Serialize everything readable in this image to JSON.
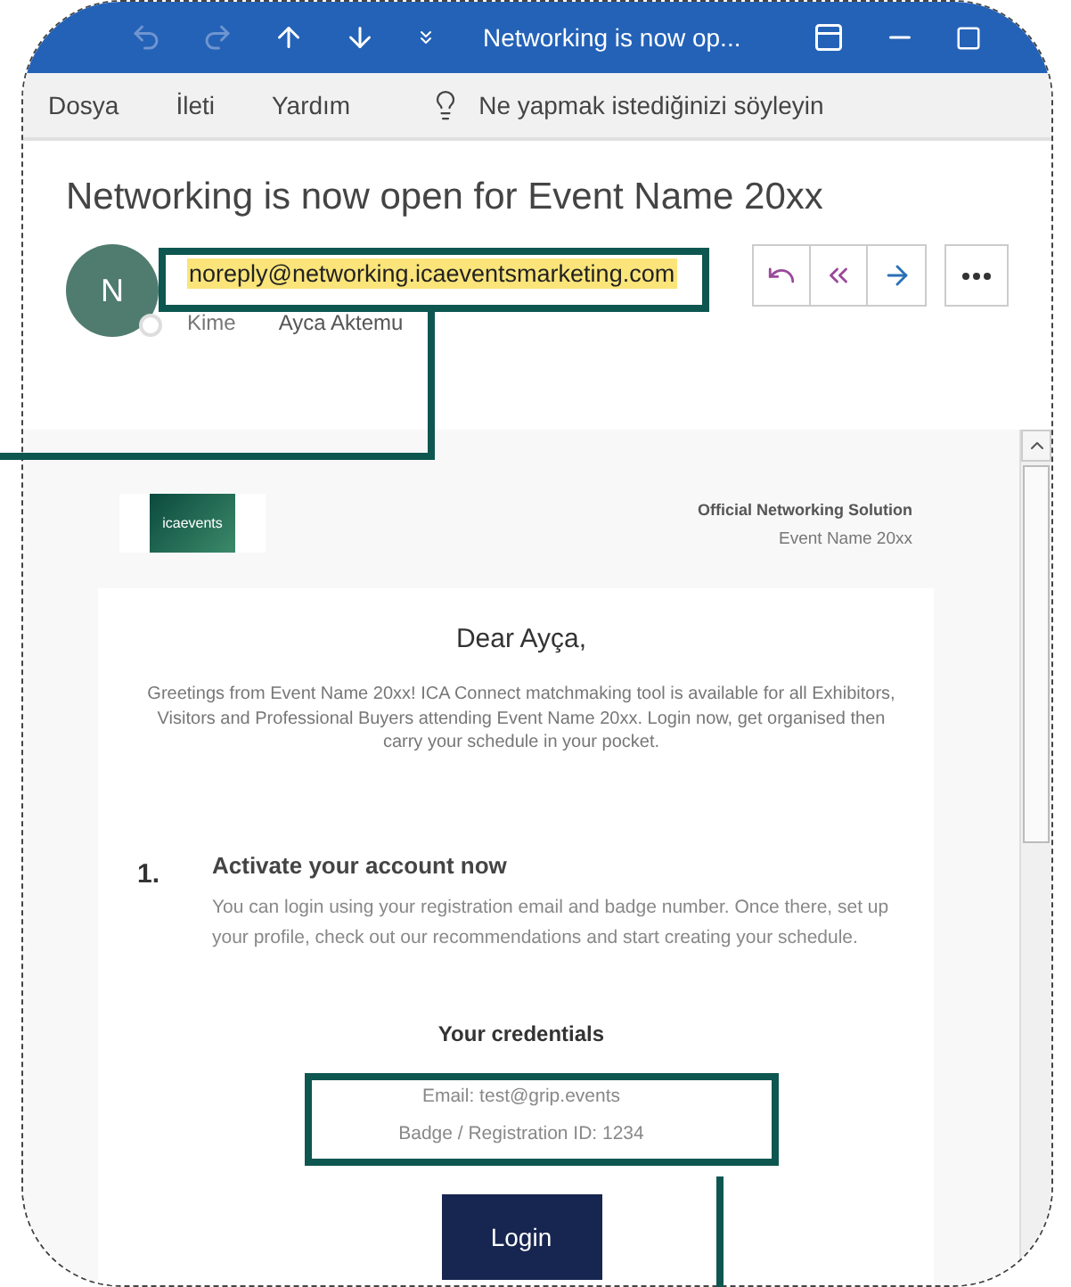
{
  "window": {
    "title": "Networking is now op..."
  },
  "menu": [
    {
      "label": "Dosya"
    },
    {
      "label": "İleti"
    },
    {
      "label": "Yardım"
    }
  ],
  "tell_me": {
    "placeholder": "Ne yapmak istediğinizi söyleyin"
  },
  "message": {
    "subject": "Networking is now open for Event Name 20xx",
    "sender_initial": "N",
    "sender_address": "noreply@networking.icaeventsmarketing.com",
    "sender_highlighted": true,
    "to_label": "Kime",
    "recipient": "Ayca Aktemu"
  },
  "email": {
    "logo_text": "icaevents",
    "header_title": "Official Networking Solution",
    "header_event": "Event Name 20xx",
    "greeting": "Dear Ayça,",
    "intro": "Greetings from Event Name 20xx! ICA Connect matchmaking tool is available for all Exhibitors, Visitors and Professional Buyers attending Event Name 20xx. Login now, get organised then carry your schedule in your pocket.",
    "steps": [
      {
        "number": "1.",
        "title": "Activate your account now",
        "body": "You can login using your registration email and badge number. Once there, set up your profile, check out our recommendations and start creating your schedule."
      }
    ],
    "credentials_title": "Your credentials",
    "credentials": [
      "Email: test@grip.events",
      "Badge / Registration ID: 1234"
    ],
    "button": "Login"
  }
}
